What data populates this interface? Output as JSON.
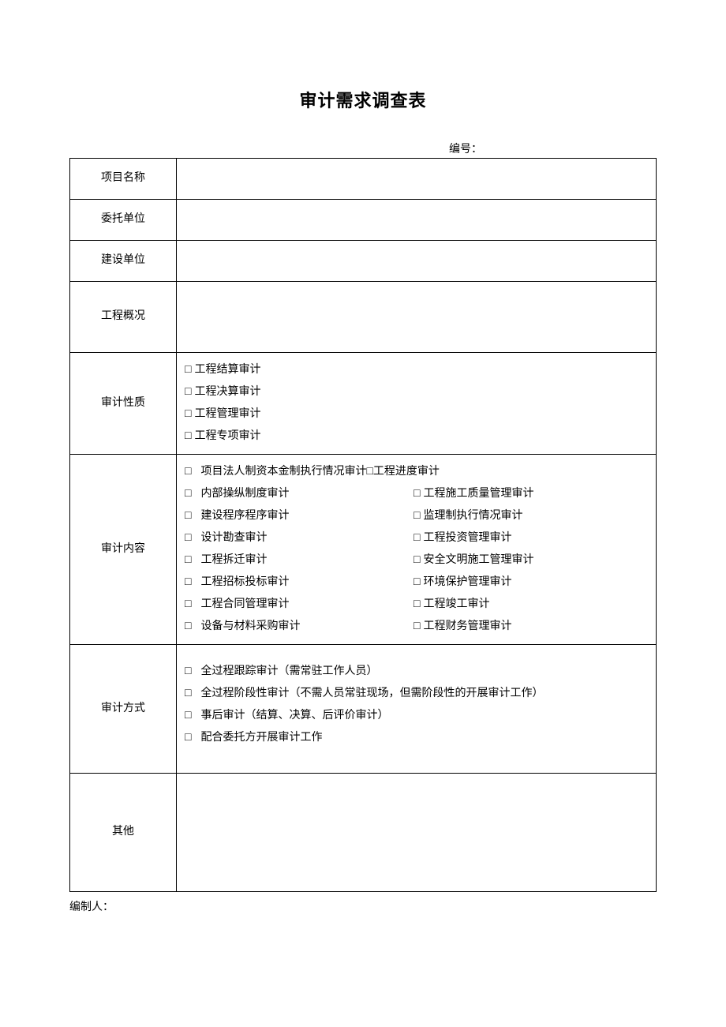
{
  "title": "审计需求调查表",
  "serial_label": "编号：",
  "rows": {
    "project_name": "项目名称",
    "client_unit": "委托单位",
    "construction_unit": "建设单位",
    "project_overview": "工程概况",
    "audit_nature": "审计性质",
    "audit_content": "审计内容",
    "audit_method": "审计方式",
    "other": "其他"
  },
  "audit_nature_items": [
    "工程结算审计",
    "工程决算审计",
    "工程管理审计",
    "工程专项审计"
  ],
  "audit_content_first_line": "项目法人制资本金制执行情况审计□工程进度审计",
  "audit_content_left": [
    "内部操纵制度审计",
    "建设程序程序审计",
    "设计勘查审计",
    "工程拆迁审计",
    "工程招标投标审计",
    "工程合同管理审计",
    "设备与材料采购审计"
  ],
  "audit_content_right": [
    "工程施工质量管理审计",
    "监理制执行情况审计",
    "工程投资管理审计",
    "安全文明施工管理审计",
    "环境保护管理审计",
    "工程竣工审计",
    "工程财务管理审计"
  ],
  "audit_method_items": [
    "全过程跟踪审计（需常驻工作人员）",
    "全过程阶段性审计（不需人员常驻现场，但需阶段性的开展审计工作）",
    "事后审计（结算、决算、后评价审计）",
    "配合委托方开展审计工作"
  ],
  "footer": "编制人："
}
